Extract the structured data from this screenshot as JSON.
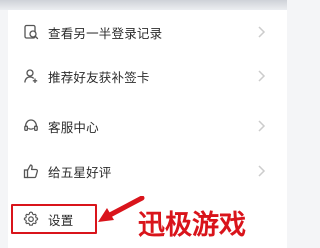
{
  "menu": {
    "items": [
      {
        "label": "查看另一半登录记录",
        "icon": "document-search-icon"
      },
      {
        "label": "推荐好友获补签卡",
        "icon": "user-add-icon"
      },
      {
        "label": "客服中心",
        "icon": "customer-service-icon"
      },
      {
        "label": "给五星好评",
        "icon": "thumbs-up-icon"
      },
      {
        "label": "设置",
        "icon": "gear-icon"
      }
    ]
  },
  "annotation": {
    "highlight_color": "#d9141b"
  },
  "watermark": {
    "text": "迅极游戏"
  },
  "colors": {
    "text": "#2b2b2b",
    "icon": "#555555",
    "chevron": "#cccccc",
    "accent_red": "#d9141b"
  }
}
